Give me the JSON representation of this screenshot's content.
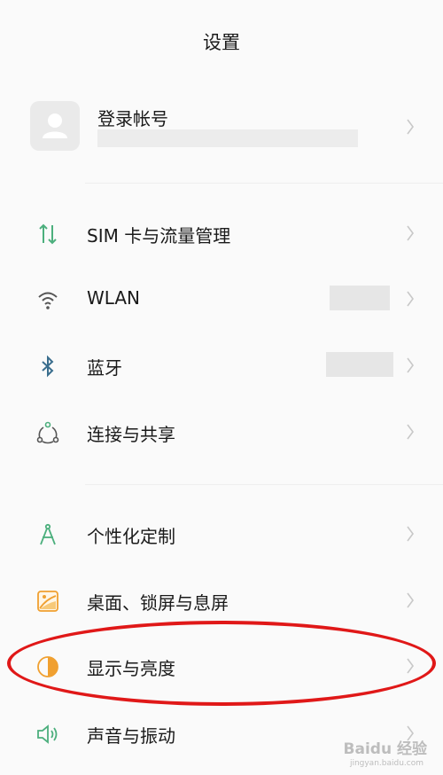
{
  "header": {
    "title": "设置"
  },
  "account": {
    "title": "登录帐号"
  },
  "sections": [
    [
      {
        "id": "sim",
        "label": "SIM 卡与流量管理",
        "icon": "sim-data-icon",
        "has_value": false
      },
      {
        "id": "wlan",
        "label": "WLAN",
        "icon": "wifi-icon",
        "has_value": true
      },
      {
        "id": "bluetooth",
        "label": "蓝牙",
        "icon": "bluetooth-icon",
        "has_value": true
      },
      {
        "id": "connection",
        "label": "连接与共享",
        "icon": "connection-share-icon",
        "has_value": false
      }
    ],
    [
      {
        "id": "personalization",
        "label": "个性化定制",
        "icon": "compass-icon",
        "has_value": false
      },
      {
        "id": "desktop",
        "label": "桌面、锁屏与息屏",
        "icon": "wallpaper-icon",
        "has_value": false
      },
      {
        "id": "display",
        "label": "显示与亮度",
        "icon": "brightness-icon",
        "has_value": false,
        "highlighted": true
      },
      {
        "id": "sound",
        "label": "声音与振动",
        "icon": "speaker-icon",
        "has_value": false
      }
    ]
  ],
  "colors": {
    "accent_green": "#4caf7d",
    "accent_orange": "#f0a030",
    "highlight_red": "#e01818",
    "chevron": "#c8c8c8"
  },
  "watermark": {
    "brand": "Baidu 经验",
    "url": "jingyan.baidu.com"
  }
}
